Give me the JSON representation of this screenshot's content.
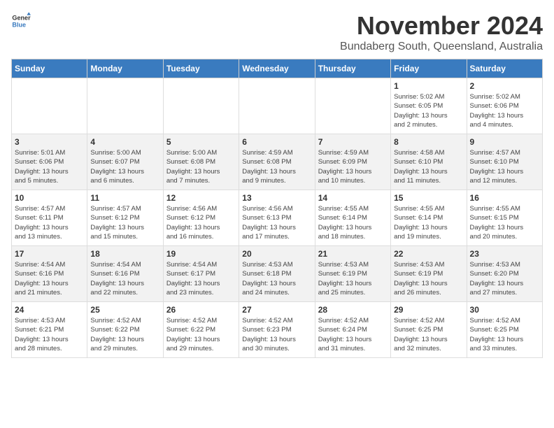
{
  "logo": {
    "general": "General",
    "blue": "Blue"
  },
  "title": "November 2024",
  "subtitle": "Bundaberg South, Queensland, Australia",
  "weekdays": [
    "Sunday",
    "Monday",
    "Tuesday",
    "Wednesday",
    "Thursday",
    "Friday",
    "Saturday"
  ],
  "weeks": [
    [
      {
        "day": "",
        "info": ""
      },
      {
        "day": "",
        "info": ""
      },
      {
        "day": "",
        "info": ""
      },
      {
        "day": "",
        "info": ""
      },
      {
        "day": "",
        "info": ""
      },
      {
        "day": "1",
        "info": "Sunrise: 5:02 AM\nSunset: 6:05 PM\nDaylight: 13 hours\nand 2 minutes."
      },
      {
        "day": "2",
        "info": "Sunrise: 5:02 AM\nSunset: 6:06 PM\nDaylight: 13 hours\nand 4 minutes."
      }
    ],
    [
      {
        "day": "3",
        "info": "Sunrise: 5:01 AM\nSunset: 6:06 PM\nDaylight: 13 hours\nand 5 minutes."
      },
      {
        "day": "4",
        "info": "Sunrise: 5:00 AM\nSunset: 6:07 PM\nDaylight: 13 hours\nand 6 minutes."
      },
      {
        "day": "5",
        "info": "Sunrise: 5:00 AM\nSunset: 6:08 PM\nDaylight: 13 hours\nand 7 minutes."
      },
      {
        "day": "6",
        "info": "Sunrise: 4:59 AM\nSunset: 6:08 PM\nDaylight: 13 hours\nand 9 minutes."
      },
      {
        "day": "7",
        "info": "Sunrise: 4:59 AM\nSunset: 6:09 PM\nDaylight: 13 hours\nand 10 minutes."
      },
      {
        "day": "8",
        "info": "Sunrise: 4:58 AM\nSunset: 6:10 PM\nDaylight: 13 hours\nand 11 minutes."
      },
      {
        "day": "9",
        "info": "Sunrise: 4:57 AM\nSunset: 6:10 PM\nDaylight: 13 hours\nand 12 minutes."
      }
    ],
    [
      {
        "day": "10",
        "info": "Sunrise: 4:57 AM\nSunset: 6:11 PM\nDaylight: 13 hours\nand 13 minutes."
      },
      {
        "day": "11",
        "info": "Sunrise: 4:57 AM\nSunset: 6:12 PM\nDaylight: 13 hours\nand 15 minutes."
      },
      {
        "day": "12",
        "info": "Sunrise: 4:56 AM\nSunset: 6:12 PM\nDaylight: 13 hours\nand 16 minutes."
      },
      {
        "day": "13",
        "info": "Sunrise: 4:56 AM\nSunset: 6:13 PM\nDaylight: 13 hours\nand 17 minutes."
      },
      {
        "day": "14",
        "info": "Sunrise: 4:55 AM\nSunset: 6:14 PM\nDaylight: 13 hours\nand 18 minutes."
      },
      {
        "day": "15",
        "info": "Sunrise: 4:55 AM\nSunset: 6:14 PM\nDaylight: 13 hours\nand 19 minutes."
      },
      {
        "day": "16",
        "info": "Sunrise: 4:55 AM\nSunset: 6:15 PM\nDaylight: 13 hours\nand 20 minutes."
      }
    ],
    [
      {
        "day": "17",
        "info": "Sunrise: 4:54 AM\nSunset: 6:16 PM\nDaylight: 13 hours\nand 21 minutes."
      },
      {
        "day": "18",
        "info": "Sunrise: 4:54 AM\nSunset: 6:16 PM\nDaylight: 13 hours\nand 22 minutes."
      },
      {
        "day": "19",
        "info": "Sunrise: 4:54 AM\nSunset: 6:17 PM\nDaylight: 13 hours\nand 23 minutes."
      },
      {
        "day": "20",
        "info": "Sunrise: 4:53 AM\nSunset: 6:18 PM\nDaylight: 13 hours\nand 24 minutes."
      },
      {
        "day": "21",
        "info": "Sunrise: 4:53 AM\nSunset: 6:19 PM\nDaylight: 13 hours\nand 25 minutes."
      },
      {
        "day": "22",
        "info": "Sunrise: 4:53 AM\nSunset: 6:19 PM\nDaylight: 13 hours\nand 26 minutes."
      },
      {
        "day": "23",
        "info": "Sunrise: 4:53 AM\nSunset: 6:20 PM\nDaylight: 13 hours\nand 27 minutes."
      }
    ],
    [
      {
        "day": "24",
        "info": "Sunrise: 4:53 AM\nSunset: 6:21 PM\nDaylight: 13 hours\nand 28 minutes."
      },
      {
        "day": "25",
        "info": "Sunrise: 4:52 AM\nSunset: 6:22 PM\nDaylight: 13 hours\nand 29 minutes."
      },
      {
        "day": "26",
        "info": "Sunrise: 4:52 AM\nSunset: 6:22 PM\nDaylight: 13 hours\nand 29 minutes."
      },
      {
        "day": "27",
        "info": "Sunrise: 4:52 AM\nSunset: 6:23 PM\nDaylight: 13 hours\nand 30 minutes."
      },
      {
        "day": "28",
        "info": "Sunrise: 4:52 AM\nSunset: 6:24 PM\nDaylight: 13 hours\nand 31 minutes."
      },
      {
        "day": "29",
        "info": "Sunrise: 4:52 AM\nSunset: 6:25 PM\nDaylight: 13 hours\nand 32 minutes."
      },
      {
        "day": "30",
        "info": "Sunrise: 4:52 AM\nSunset: 6:25 PM\nDaylight: 13 hours\nand 33 minutes."
      }
    ]
  ]
}
